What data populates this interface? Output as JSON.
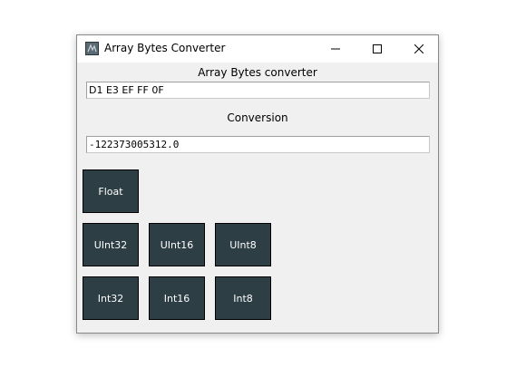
{
  "window": {
    "title": "Array Bytes Converter",
    "icon": "app-icon"
  },
  "labels": {
    "header": "Array Bytes converter",
    "conversion": "Conversion"
  },
  "input": {
    "value": "D1 E3 EF FF 0F"
  },
  "output": {
    "value": "-122373005312.0"
  },
  "buttons": {
    "float": "Float",
    "uint32": "UInt32",
    "uint16": "UInt16",
    "uint8": "UInt8",
    "int32": "Int32",
    "int16": "Int16",
    "int8": "Int8"
  },
  "colors": {
    "button_bg": "#2d3e45",
    "button_text": "#ffffff",
    "window_bg": "#f0f0f0"
  }
}
